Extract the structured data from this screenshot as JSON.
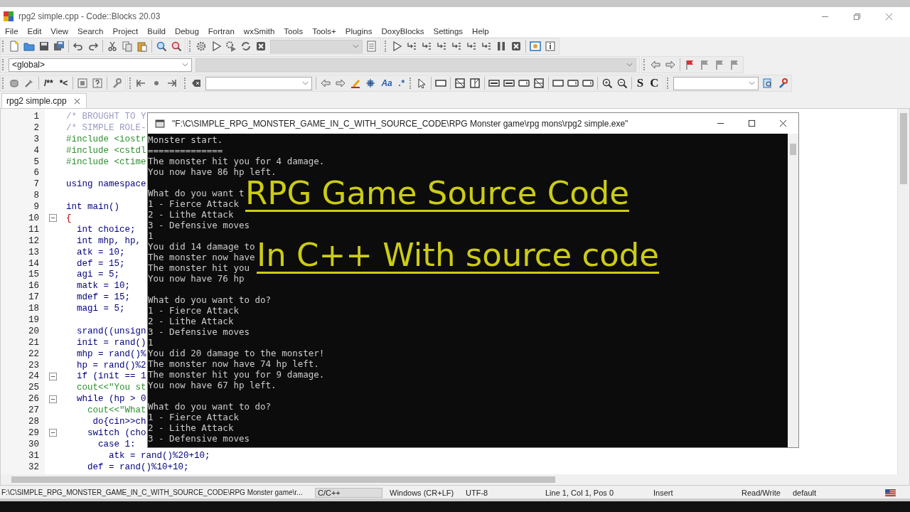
{
  "window": {
    "title": "rpg2 simple.cpp - Code::Blocks 20.03"
  },
  "menu": [
    "File",
    "Edit",
    "View",
    "Search",
    "Project",
    "Build",
    "Debug",
    "Fortran",
    "wxSmith",
    "Tools",
    "Tools+",
    "Plugins",
    "DoxyBlocks",
    "Settings",
    "Help"
  ],
  "toolbar": {
    "scope": "<global>",
    "doc_comment": "/**",
    "inline_comment": "*<",
    "match_case": "Aa",
    "regex": ".*",
    "bold_s": "S",
    "bold_c": "C"
  },
  "tabs": [
    {
      "label": "rpg2 simple.cpp",
      "selected": true
    }
  ],
  "editor": {
    "lines": [
      {
        "number": "1",
        "kind": "comment",
        "text": "/* BROUGHT TO Y",
        "fold": false
      },
      {
        "number": "2",
        "kind": "comment",
        "text": "/* SIMPLE ROLE-",
        "fold": false
      },
      {
        "number": "3",
        "kind": "preprocessor",
        "text": "#include <iostr",
        "fold": false
      },
      {
        "number": "4",
        "kind": "preprocessor",
        "text": "#include <cstdl",
        "fold": false
      },
      {
        "number": "5",
        "kind": "preprocessor",
        "text": "#include <ctime",
        "fold": false
      },
      {
        "number": "6",
        "fold": false
      },
      {
        "number": "7",
        "kind": "keyword",
        "text": "using namespace",
        "fold": false
      },
      {
        "number": "8",
        "fold": false
      },
      {
        "number": "9",
        "kind": "code",
        "text": "int main()",
        "fold": false
      },
      {
        "number": "10",
        "kind": "brace",
        "text": "{",
        "fold": true
      },
      {
        "number": "11",
        "kind": "code",
        "text": "  int choice;",
        "fold": false
      },
      {
        "number": "12",
        "kind": "code",
        "text": "  int mhp, hp,",
        "fold": false
      },
      {
        "number": "13",
        "kind": "code",
        "text": "  atk = 10;",
        "fold": false
      },
      {
        "number": "14",
        "kind": "code",
        "text": "  def = 15;",
        "fold": false
      },
      {
        "number": "15",
        "kind": "code",
        "text": "  agi = 5;",
        "fold": false
      },
      {
        "number": "16",
        "kind": "code",
        "text": "  matk = 10;",
        "fold": false
      },
      {
        "number": "17",
        "kind": "code",
        "text": "  mdef = 15;",
        "fold": false
      },
      {
        "number": "18",
        "kind": "code",
        "text": "  magi = 5;",
        "fold": false
      },
      {
        "number": "19",
        "fold": false
      },
      {
        "number": "20",
        "kind": "code",
        "text": "  srand((unsign",
        "fold": false
      },
      {
        "number": "21",
        "kind": "code",
        "text": "  init = rand()",
        "fold": false
      },
      {
        "number": "22",
        "kind": "code",
        "text": "  mhp = rand()%",
        "fold": false
      },
      {
        "number": "23",
        "kind": "code",
        "text": "  hp = rand()%2",
        "fold": false
      },
      {
        "number": "24",
        "kind": "code",
        "text": "  if (init == 1",
        "fold": true
      },
      {
        "number": "25",
        "kind": "stream",
        "text": "  cout<<\"You st",
        "fold": false
      },
      {
        "number": "26",
        "kind": "code",
        "text": "  while (hp > 0",
        "fold": true
      },
      {
        "number": "27",
        "kind": "stream",
        "text": "    cout<<\"What",
        "fold": false
      },
      {
        "number": "28",
        "kind": "code",
        "text": "     do{cin>>ch",
        "fold": false
      },
      {
        "number": "29",
        "kind": "code",
        "text": "    switch (cho",
        "fold": true
      },
      {
        "number": "30",
        "kind": "code",
        "text": "      case 1:",
        "fold": false
      },
      {
        "number": "31",
        "kind": "code",
        "text": "        atk = rand()%20+10;",
        "fold": false
      },
      {
        "number": "32",
        "kind": "code",
        "text": "    def = rand()%10+10;",
        "fold": false
      }
    ]
  },
  "console": {
    "title": "\"F:\\C\\SIMPLE_RPG_MONSTER_GAME_IN_C_WITH_SOURCE_CODE\\RPG Monster game\\rpg mons\\rpg2 simple.exe\"",
    "blocks": [
      [
        "Monster start.",
        "==============",
        "The monster hit you for 4 damage.",
        "You now have 86 hp left."
      ],
      [
        "What do you want t",
        "1 - Fierce Attack",
        "2 - Lithe Attack",
        "3 - Defensive moves",
        "1",
        "You did 14 damage to",
        "The monster now have",
        "The monster hit you",
        "You now have 76 hp"
      ],
      [
        "What do you want to do?",
        "1 - Fierce Attack",
        "2 - Lithe Attack",
        "3 - Defensive moves",
        "1",
        "You did 20 damage to the monster!",
        "The monster now have 74 hp left.",
        "The monster hit you for 9 damage.",
        "You now have 67 hp left."
      ],
      [
        "What do you want to do?",
        "1 - Fierce Attack",
        "2 - Lithe Attack",
        "3 - Defensive moves"
      ]
    ]
  },
  "overlay": {
    "lines": [
      "RPG Game Source Code",
      "In C++ With source code"
    ]
  },
  "status_bar": [
    "F:\\C\\SIMPLE_RPG_MONSTER_GAME_IN_C_WITH_SOURCE_CODE\\RPG Monster game\\r...",
    "C/C++",
    "Windows (CR+LF)",
    "UTF-8",
    "Line 1, Col 1, Pos 0",
    "Insert",
    "Read/Write",
    "default"
  ]
}
